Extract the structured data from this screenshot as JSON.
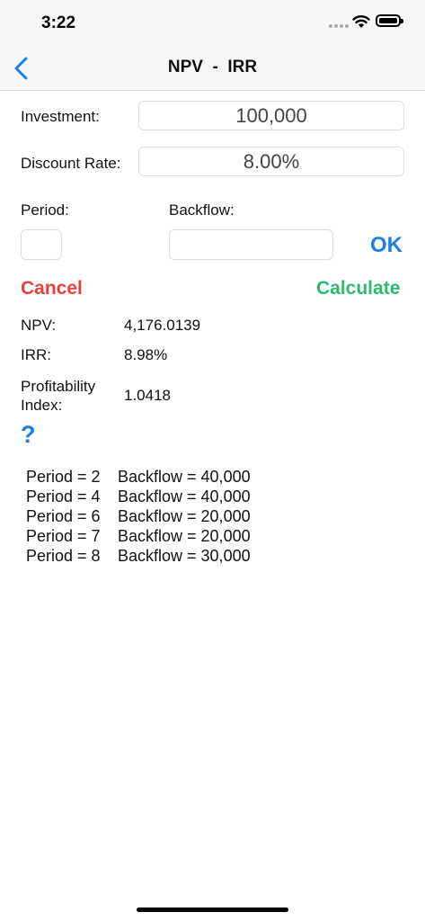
{
  "status": {
    "time": "3:22"
  },
  "nav": {
    "title": "NPV  -  IRR",
    "back_icon": "chevron-left-icon"
  },
  "form": {
    "investment_label": "Investment:",
    "investment_value": "100,000",
    "discount_label": "Discount Rate:",
    "discount_value": "8.00%",
    "period_label": "Period:",
    "backflow_label": "Backflow:",
    "period_value": "",
    "backflow_value": "",
    "ok_label": "OK"
  },
  "actions": {
    "cancel_label": "Cancel",
    "calculate_label": "Calculate"
  },
  "results": {
    "npv_label": "NPV:",
    "npv_value": "4,176.0139",
    "irr_label": "IRR:",
    "irr_value": "8.98%",
    "pi_label_1": "Profitability",
    "pi_label_2": "Index:",
    "pi_value": "1.0418"
  },
  "help_label": "?",
  "cashflows": [
    {
      "period": "Period = 2",
      "backflow": "Backflow = 40,000"
    },
    {
      "period": "Period = 4",
      "backflow": "Backflow = 40,000"
    },
    {
      "period": "Period = 6",
      "backflow": "Backflow = 20,000"
    },
    {
      "period": "Period = 7",
      "backflow": "Backflow = 20,000"
    },
    {
      "period": "Period = 8",
      "backflow": "Backflow = 30,000"
    }
  ],
  "colors": {
    "blue": "#1a7fe0",
    "red": "#e5413a",
    "green": "#2bbb6e"
  }
}
